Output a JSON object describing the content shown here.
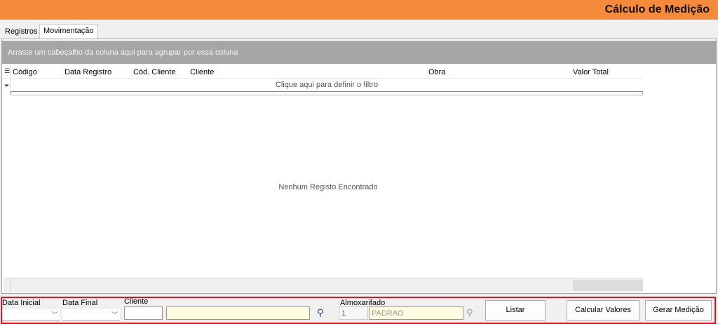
{
  "window": {
    "title": "Cálculo de Medição"
  },
  "tabs": [
    {
      "label": "Registros",
      "active": false
    },
    {
      "label": "Movimentação",
      "active": true
    }
  ],
  "grid": {
    "group_hint": "Arraste um cabeçalho da coluna aqui para agrupar por essa coluna",
    "columns": [
      "Código",
      "Data Registro",
      "Cód. Cliente",
      "Cliente",
      "Obra",
      "Valor Total"
    ],
    "filter_hint": "Clique aqui para definir o filtro",
    "empty_text": "Nenhum Registo Encontrado"
  },
  "filters": {
    "data_inicial_label": "Data Inicial",
    "data_final_label": "Data Final",
    "cliente_label": "Cliente",
    "cliente_code": "",
    "cliente_name": "",
    "almoxarifado_label": "Almoxarifado",
    "almoxarifado_code": "1",
    "almoxarifado_name": "PADRAO"
  },
  "buttons": {
    "listar": "Listar",
    "calcular": "Calcular Valores",
    "gerar": "Gerar Medição"
  },
  "icons": {
    "search_cliente": "binoculars-icon",
    "search_almox": "binoculars-icon"
  },
  "colors": {
    "header": "#f58a3a",
    "highlight_border": "#e0141e"
  }
}
